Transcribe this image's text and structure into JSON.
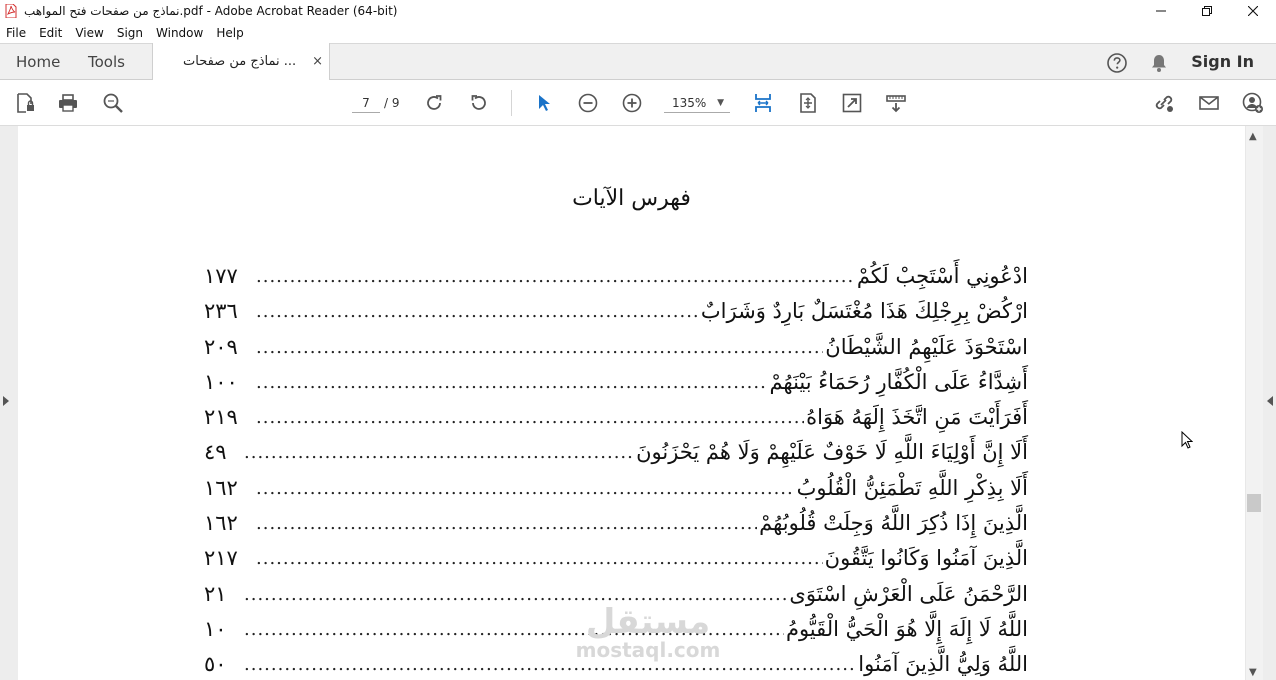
{
  "window": {
    "title": "نماذج من صفحات فتح المواهب.pdf - Adobe Acrobat Reader (64-bit)"
  },
  "menu": [
    "File",
    "Edit",
    "View",
    "Sign",
    "Window",
    "Help"
  ],
  "tabs": {
    "home": "Home",
    "tools": "Tools",
    "document": "نماذج من صفحات ...",
    "close": "×",
    "sign_in": "Sign In"
  },
  "toolbar": {
    "page_current": "7",
    "page_total": "/  9",
    "zoom": "135%"
  },
  "document": {
    "heading": "فهرس الآيات",
    "entries": [
      {
        "verse": "ادْعُونِي أَسْتَجِبْ لَكُمْ",
        "page": "١٧٧"
      },
      {
        "verse": "ارْكُضْ بِرِجْلِكَ هَذَا مُغْتَسَلٌ بَارِدٌ وَشَرَابٌ",
        "page": "٢٣٦"
      },
      {
        "verse": "اسْتَحْوَذَ عَلَيْهِمُ الشَّيْطَانُ",
        "page": "٢٠٩"
      },
      {
        "verse": "أَشِدَّاءُ عَلَى الْكُفَّارِ رُحَمَاءُ بَيْنَهُمْ",
        "page": "١٠٠"
      },
      {
        "verse": "أَفَرَأَيْتَ مَنِ اتَّخَذَ إِلَهَهُ هَوَاهُ",
        "page": "٢١٩"
      },
      {
        "verse": "أَلَا إِنَّ أَوْلِيَاءَ اللَّهِ لَا خَوْفٌ عَلَيْهِمْ وَلَا هُمْ يَحْزَنُونَ",
        "page": "٤٩"
      },
      {
        "verse": "أَلَا بِذِكْرِ اللَّهِ تَطْمَئِنُّ الْقُلُوبُ",
        "page": "١٦٢"
      },
      {
        "verse": "الَّذِينَ إِذَا ذُكِرَ اللَّهُ وَجِلَتْ قُلُوبُهُمْ",
        "page": "١٦٢"
      },
      {
        "verse": "الَّذِينَ آمَنُوا وَكَانُوا يَتَّقُونَ",
        "page": "٢١٧"
      },
      {
        "verse": "الرَّحْمَنُ عَلَى الْعَرْشِ اسْتَوَى",
        "page": "٢١"
      },
      {
        "verse": "اللَّهُ لَا إِلَهَ إِلَّا هُوَ الْحَيُّ الْقَيُّومُ",
        "page": "١٠"
      },
      {
        "verse": "اللَّهُ وَلِيُّ الَّذِينَ آمَنُوا",
        "page": "٥٠"
      }
    ]
  },
  "watermark": {
    "arabic": "مستقل",
    "latin": "mostaql.com"
  },
  "colors": {
    "accent_blue": "#1a73c8",
    "icon_gray": "#555555",
    "pdf_red": "#d32f2f"
  }
}
